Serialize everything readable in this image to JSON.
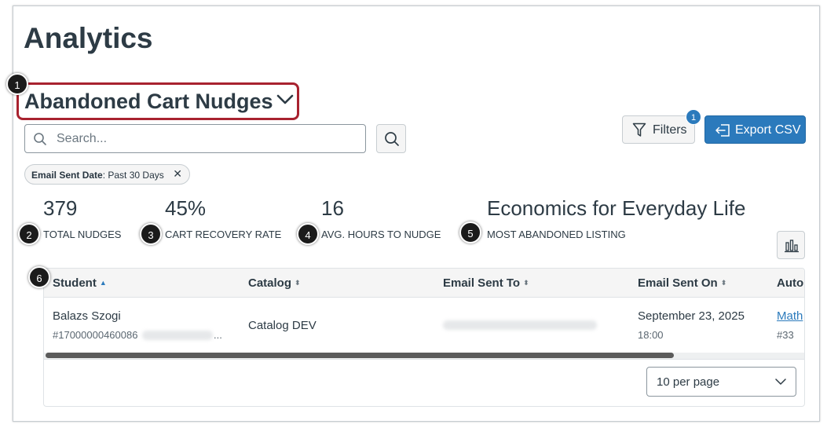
{
  "page": {
    "title": "Analytics"
  },
  "report_selector": {
    "value": "Abandoned Cart Nudges",
    "icon": "chevron-down-icon"
  },
  "search": {
    "placeholder": "Search...",
    "value": ""
  },
  "toolbar": {
    "filters_label": "Filters",
    "filters_count": "1",
    "export_label": "Export CSV",
    "accent": "#2b7abc"
  },
  "active_filter": {
    "name": "Email Sent Date",
    "value": ": Past 30 Days",
    "remove": "✕"
  },
  "stats": [
    {
      "value": "379",
      "label": "TOTAL NUDGES"
    },
    {
      "value": "45%",
      "label": "CART RECOVERY RATE"
    },
    {
      "value": "16",
      "label": "AVG. HOURS TO NUDGE"
    },
    {
      "value": "Economics for Everyday Life",
      "label": "MOST ABANDONED LISTING"
    }
  ],
  "callouts": [
    "1",
    "2",
    "3",
    "4",
    "5",
    "6"
  ],
  "table": {
    "columns": [
      {
        "label": "Student",
        "sort": "▲"
      },
      {
        "label": "Catalog",
        "sort": "⬍"
      },
      {
        "label": "Email Sent To",
        "sort": "⬍"
      },
      {
        "label": "Email Sent On",
        "sort": "⬍"
      },
      {
        "label": "Auto"
      }
    ],
    "rows": [
      {
        "student": "Balazs Szogi",
        "student_id": "#17000000460086",
        "student_id_more": "...",
        "catalog": "Catalog DEV",
        "email_sent_on": "September 23, 2025",
        "email_sent_time": "18:00",
        "auto_link": "Math",
        "auto_sub": "#33"
      }
    ],
    "per_page": "10 per page"
  }
}
